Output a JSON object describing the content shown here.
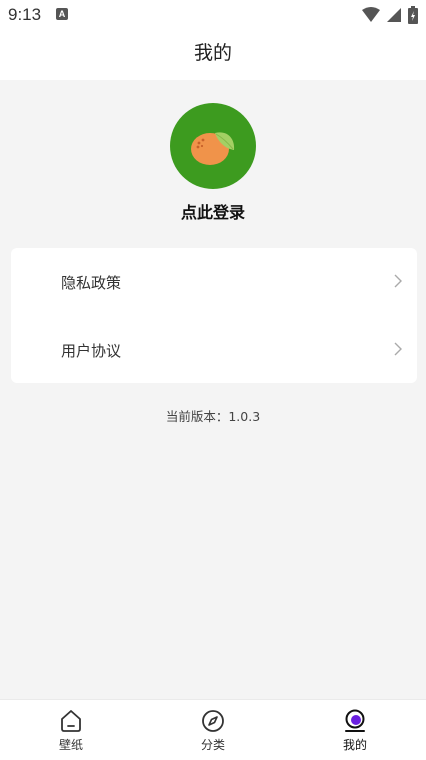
{
  "status_bar": {
    "time": "9:13",
    "notification_glyph": "A"
  },
  "header": {
    "title": "我的"
  },
  "profile": {
    "login_prompt": "点此登录",
    "avatar_icon": "orange-fruit-icon"
  },
  "menu": {
    "items": [
      {
        "label": "隐私政策",
        "icon": "chevron-right-icon"
      },
      {
        "label": "用户协议",
        "icon": "chevron-right-icon"
      }
    ]
  },
  "version_text": "当前版本：1.0.3",
  "tabs": [
    {
      "label": "壁纸",
      "icon": "home-icon",
      "active": false
    },
    {
      "label": "分类",
      "icon": "compass-icon",
      "active": false
    },
    {
      "label": "我的",
      "icon": "profile-icon",
      "active": true
    }
  ],
  "colors": {
    "avatar_bg": "#3d9b1f",
    "active_tab_accent": "#6a1fe0",
    "page_bg": "#f4f4f4"
  }
}
